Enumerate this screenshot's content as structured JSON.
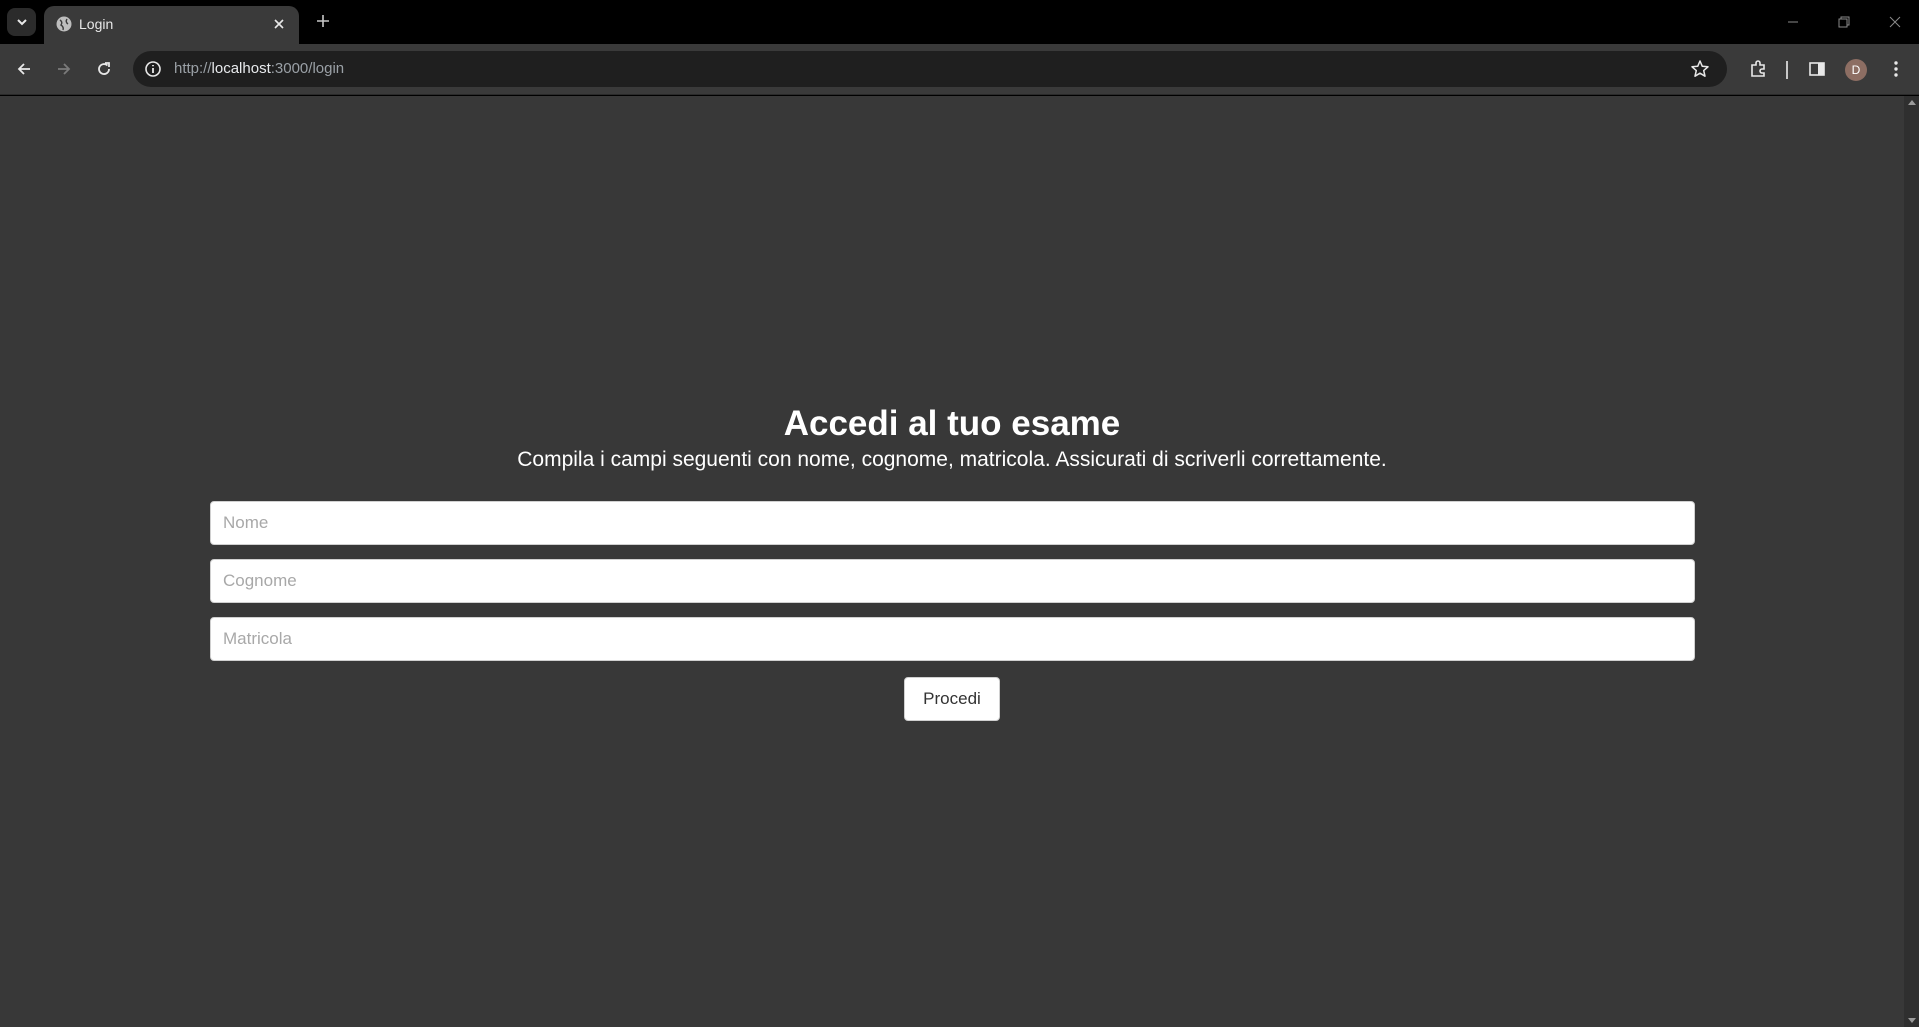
{
  "browser": {
    "tab_title": "Login",
    "url_scheme": "http://",
    "url_host": "localhost",
    "url_rest": ":3000/login",
    "profile_initial": "D",
    "profile_color": "#8d6e63"
  },
  "page": {
    "background": "#383838",
    "title": "Accedi al tuo esame",
    "subtitle": "Compila i campi seguenti con nome, cognome, matricola. Assicurati di scriverli correttamente.",
    "form": {
      "nome": {
        "placeholder": "Nome",
        "value": ""
      },
      "cognome": {
        "placeholder": "Cognome",
        "value": ""
      },
      "matricola": {
        "placeholder": "Matricola",
        "value": ""
      },
      "submit_label": "Procedi"
    }
  },
  "icons": [
    "tab-search-icon",
    "globe-icon",
    "close-icon",
    "plus-icon",
    "minimize-icon",
    "restore-icon",
    "window-close-icon",
    "back-icon",
    "forward-icon",
    "reload-icon",
    "info-icon",
    "star-icon",
    "extensions-icon",
    "side-panel-icon",
    "menu-icon"
  ]
}
